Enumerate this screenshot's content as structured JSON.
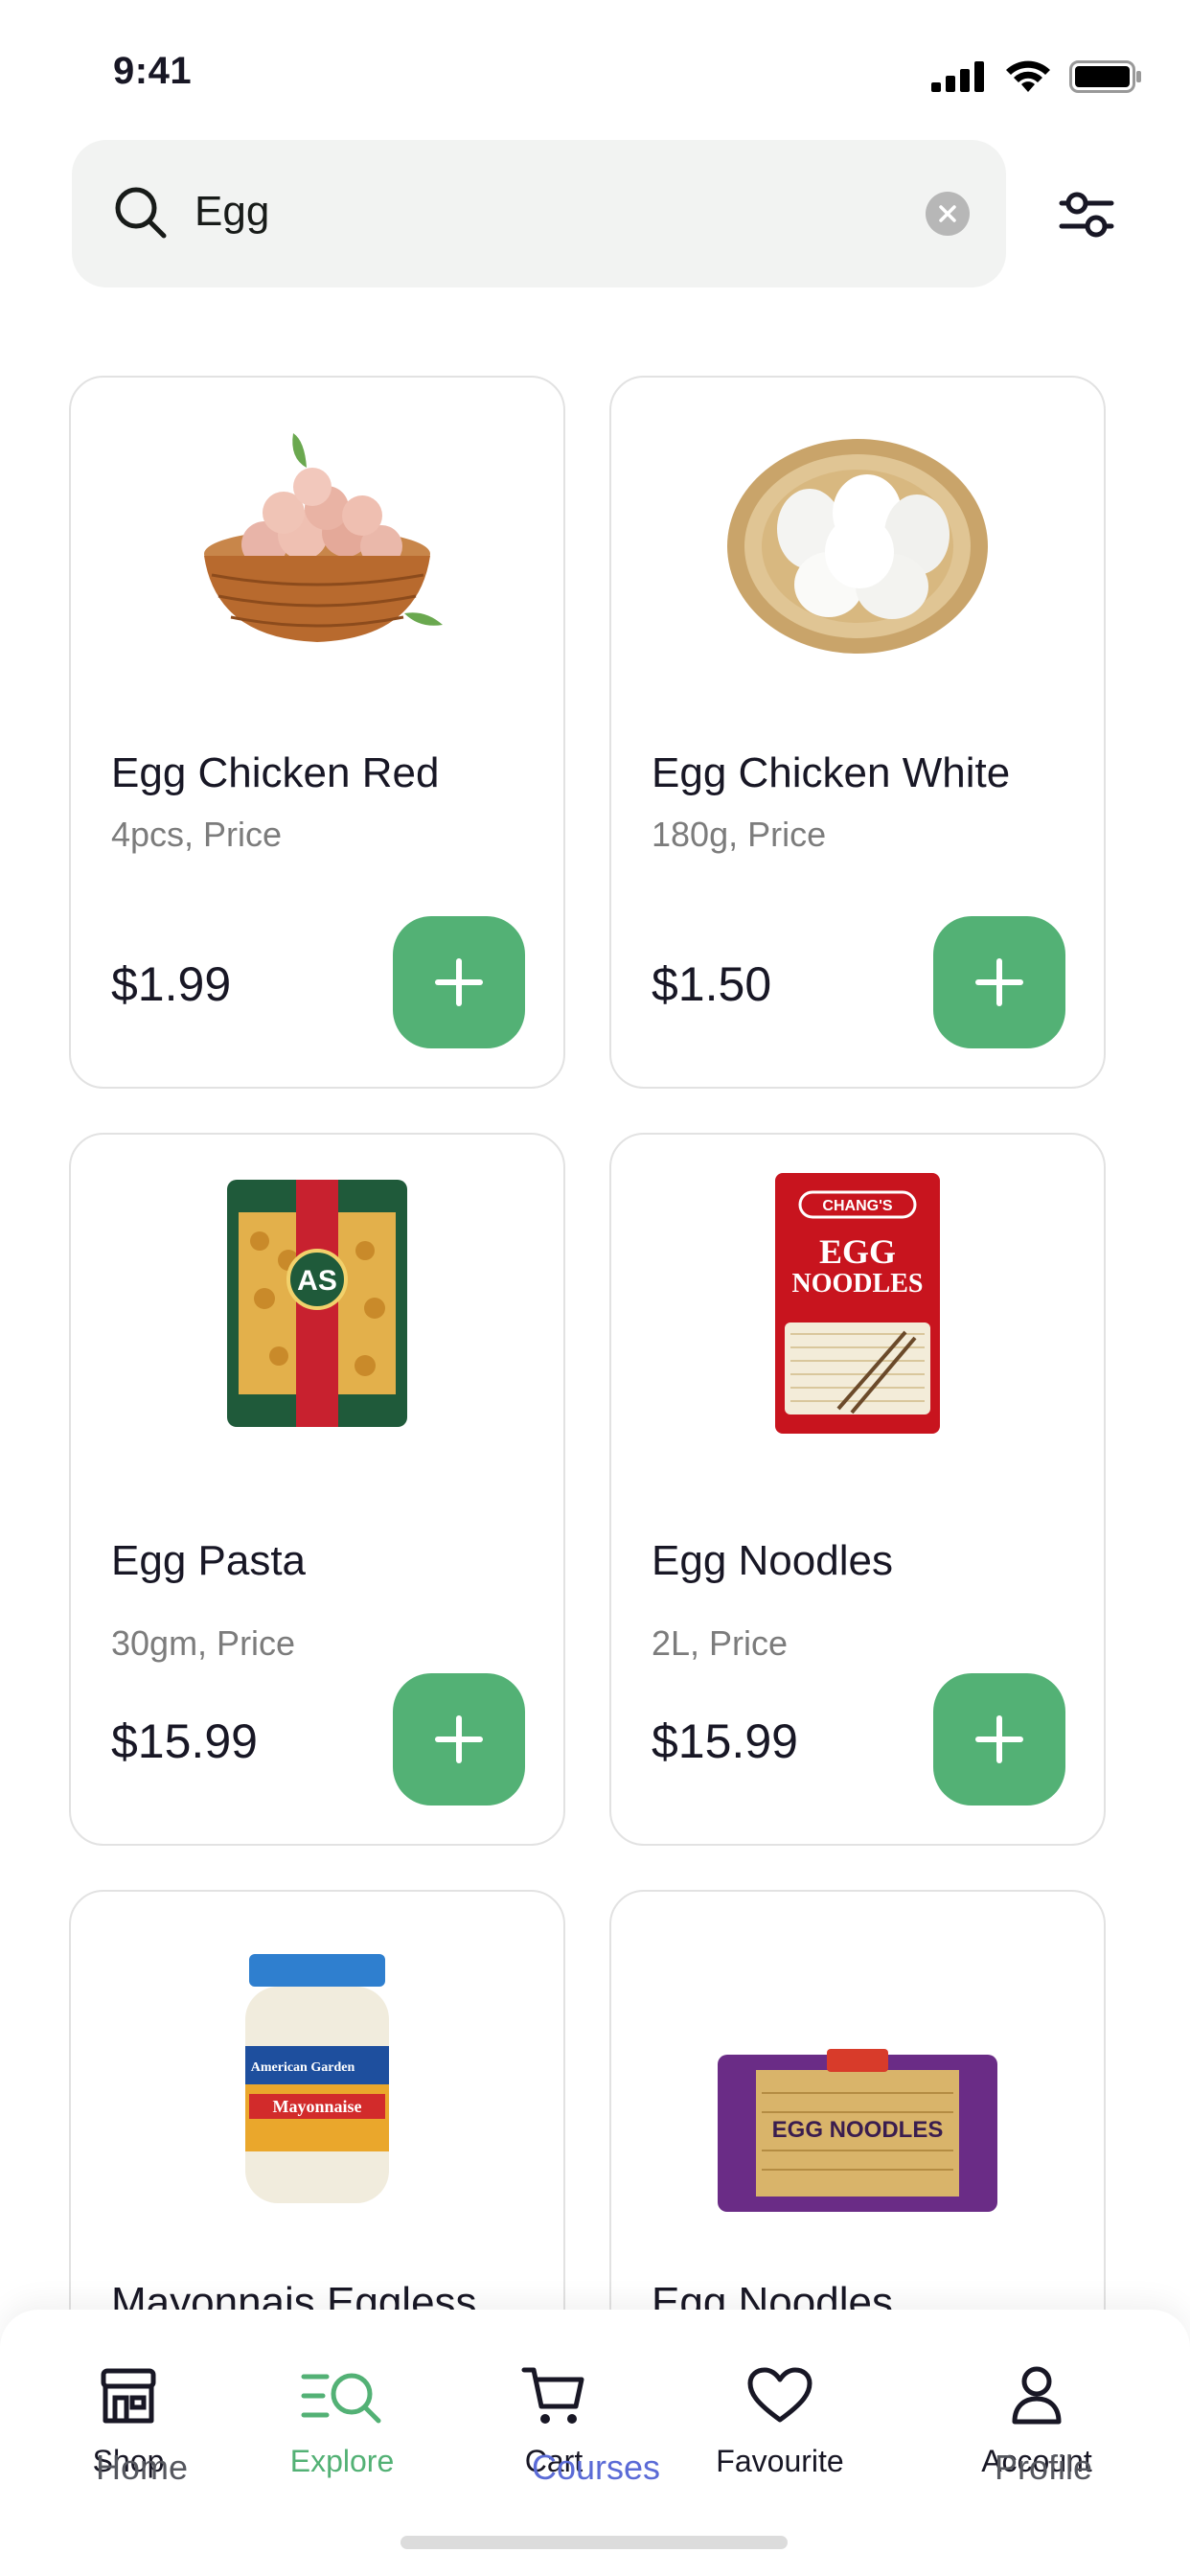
{
  "status_bar": {
    "time": "9:41"
  },
  "search": {
    "value": "Egg"
  },
  "products": [
    {
      "name": "Egg Chicken Red",
      "detail": "4pcs, Price",
      "price": "$1.99"
    },
    {
      "name": "Egg Chicken White",
      "detail": "180g, Price",
      "price": "$1.50"
    },
    {
      "name": "Egg Pasta",
      "detail": "30gm, Price",
      "price": "$15.99",
      "package_text": "AS"
    },
    {
      "name": "Egg Noodles",
      "detail": "2L, Price",
      "price": "$15.99",
      "package_text": [
        "CHANG'S",
        "EGG",
        "NOODLES"
      ]
    },
    {
      "name": "Mayonnais Eggless",
      "package_text": [
        "American Garden",
        "Mayonnaise"
      ]
    },
    {
      "name": "Egg Noodles",
      "package_text": "EGG NOODLES"
    }
  ],
  "bottom_nav": {
    "items": [
      {
        "label": "Shop",
        "icon": "store-icon"
      },
      {
        "label": "Explore",
        "icon": "explore-icon",
        "active": true
      },
      {
        "label": "Cart",
        "icon": "cart-icon"
      },
      {
        "label": "Favourite",
        "icon": "heart-icon"
      },
      {
        "label": "Account",
        "icon": "person-icon"
      }
    ],
    "overlay_labels": [
      "Home",
      "Courses",
      "Profile"
    ]
  },
  "colors": {
    "accent": "#53b175",
    "ghost_active": "#5b6bd6",
    "text": "#181725",
    "muted": "#7c7c7c"
  }
}
